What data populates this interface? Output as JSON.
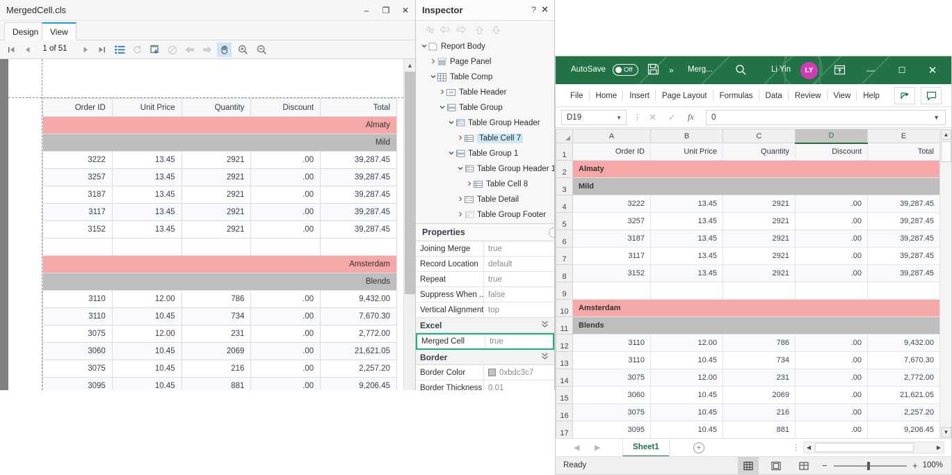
{
  "designer": {
    "title": "MergedCell.cls",
    "window_buttons": {
      "minimize": "–",
      "maximize": "❐",
      "close": "✕"
    },
    "tabs": [
      {
        "label": "Design",
        "active": false
      },
      {
        "label": "View",
        "active": true
      }
    ],
    "toolbar": {
      "first_page": "❘◀",
      "prev_page": "◀",
      "page_indicator": "1 of 51",
      "next_page": "▶",
      "last_page": "▶❘",
      "toc_icon": "list-icon",
      "refresh_icon": "refresh-icon",
      "export_icon": "export-icon",
      "stop_icon": "stop-icon",
      "back_icon": "←",
      "forward_icon": "→",
      "pan_icon": "✋",
      "zoom_in_icon": "zoom-in-icon",
      "zoom_out_icon": "zoom-out-icon"
    }
  },
  "report": {
    "columns": [
      "Order ID",
      "Unit Price",
      "Quantity",
      "Discount",
      "Total"
    ],
    "rows": [
      {
        "type": "group",
        "label": "Almaty"
      },
      {
        "type": "sub",
        "label": "Mild"
      },
      {
        "type": "data",
        "cells": [
          "3222",
          "13.45",
          "2921",
          ".00",
          "39,287.45"
        ]
      },
      {
        "type": "data",
        "cells": [
          "3257",
          "13.45",
          "2921",
          ".00",
          "39,287.45"
        ]
      },
      {
        "type": "data",
        "cells": [
          "3187",
          "13.45",
          "2921",
          ".00",
          "39,287.45"
        ]
      },
      {
        "type": "data",
        "cells": [
          "3117",
          "13.45",
          "2921",
          ".00",
          "39,287.45"
        ]
      },
      {
        "type": "data",
        "cells": [
          "3152",
          "13.45",
          "2921",
          ".00",
          "39,287.45"
        ]
      },
      {
        "type": "blank",
        "cells": [
          "",
          "",
          "",
          "",
          ""
        ]
      },
      {
        "type": "group",
        "label": "Amsterdam"
      },
      {
        "type": "sub",
        "label": "Blends"
      },
      {
        "type": "data",
        "cells": [
          "3110",
          "12.00",
          "786",
          ".00",
          "9,432.00"
        ]
      },
      {
        "type": "data",
        "cells": [
          "3110",
          "10.45",
          "734",
          ".00",
          "7,670.30"
        ]
      },
      {
        "type": "data",
        "cells": [
          "3075",
          "12.00",
          "231",
          ".00",
          "2,772.00"
        ]
      },
      {
        "type": "data",
        "cells": [
          "3060",
          "10.45",
          "2069",
          ".00",
          "21,621.05"
        ]
      },
      {
        "type": "data",
        "cells": [
          "3075",
          "10.45",
          "216",
          ".00",
          "2,257.20"
        ]
      },
      {
        "type": "data",
        "cells": [
          "3095",
          "10.45",
          "881",
          ".00",
          "9,206.45"
        ]
      }
    ]
  },
  "inspector": {
    "title": "Inspector",
    "help_icon": "?",
    "close_icon": "✕",
    "toolbar_icons": [
      "undo-arrow-icon",
      "left-arrow-icon",
      "right-arrow-icon",
      "up-arrow-icon",
      "down-arrow-icon"
    ],
    "tree": [
      {
        "label": "Report Body",
        "depth": 0,
        "twist": "⌄",
        "icon": "report-body-icon",
        "selected": false
      },
      {
        "label": "Page Panel",
        "depth": 1,
        "twist": "›",
        "icon": "page-panel-icon",
        "selected": false
      },
      {
        "label": "Table Comp",
        "depth": 1,
        "twist": "⌄",
        "icon": "table-grid-icon",
        "selected": false
      },
      {
        "label": "Table Header",
        "depth": 2,
        "twist": "›",
        "icon": "table-header-icon",
        "selected": false
      },
      {
        "label": "Table Group",
        "depth": 2,
        "twist": "⌄",
        "icon": "table-group-icon",
        "selected": false
      },
      {
        "label": "Table Group Header",
        "depth": 3,
        "twist": "⌄",
        "icon": "table-group-header-icon",
        "selected": false
      },
      {
        "label": "Table Cell 7",
        "depth": 4,
        "twist": "›",
        "icon": "table-cell-icon",
        "selected": true
      },
      {
        "label": "Table Group 1",
        "depth": 3,
        "twist": "⌄",
        "icon": "table-group-icon",
        "selected": false
      },
      {
        "label": "Table Group Header 1",
        "depth": 4,
        "twist": "⌄",
        "icon": "table-group-header-icon",
        "selected": false
      },
      {
        "label": "Table Cell 8",
        "depth": 5,
        "twist": "›",
        "icon": "table-cell-icon",
        "selected": false
      },
      {
        "label": "Table Detail",
        "depth": 4,
        "twist": "›",
        "icon": "table-detail-icon",
        "selected": false
      },
      {
        "label": "Table Group Footer",
        "depth": 4,
        "twist": "›",
        "icon": "table-group-footer-icon",
        "selected": false
      }
    ]
  },
  "properties": {
    "title": "Properties",
    "rows": [
      {
        "kind": "prop",
        "name": "Joining Merge",
        "value": "true"
      },
      {
        "kind": "prop",
        "name": "Record Location",
        "value": "default"
      },
      {
        "kind": "prop",
        "name": "Repeat",
        "value": "true"
      },
      {
        "kind": "prop",
        "name": "Suppress When ...",
        "value": "false"
      },
      {
        "kind": "prop",
        "name": "Vertical Alignment",
        "value": "top"
      },
      {
        "kind": "section",
        "name": "Excel",
        "value": ""
      },
      {
        "kind": "prop-highlight",
        "name": "Merged Cell",
        "value": "true"
      },
      {
        "kind": "section",
        "name": "Border",
        "value": ""
      },
      {
        "kind": "prop-swatch",
        "name": "Border Color",
        "value": "0xbdc3c7",
        "swatch": "#bdc3c7"
      },
      {
        "kind": "prop",
        "name": "Border Thickness",
        "value": "0.01"
      }
    ],
    "highlight_color": "#16b187"
  },
  "excel": {
    "autosave_label": "AutoSave",
    "autosave_state": "Off",
    "save_icon": "save-icon",
    "more_icon": "»",
    "document_name": "Merg...",
    "search_icon": "search-icon",
    "user_name": "Li Yin",
    "user_initials": "LY",
    "ribbon_display_icon": "ribbon-display-options-icon",
    "window_buttons": {
      "minimize": "—",
      "maximize": "☐",
      "close": "✕"
    },
    "ribbon_tabs": [
      "File",
      "Home",
      "Insert",
      "Page Layout",
      "Formulas",
      "Data",
      "Review",
      "View",
      "Help"
    ],
    "share_icon": "share-icon",
    "comment_icon": "comment-icon",
    "name_box": "D19",
    "fx_label": "fx",
    "formula_value": "0",
    "cancel_icon": "✕",
    "enter_icon": "✓",
    "titlebar_color": "#217346",
    "columns": [
      "A",
      "B",
      "C",
      "D",
      "E"
    ],
    "selected_column": "D",
    "row_numbers": [
      "1",
      "2",
      "3",
      "4",
      "5",
      "6",
      "7",
      "8",
      "9",
      "10",
      "11",
      "12",
      "13",
      "14",
      "15",
      "16",
      "17"
    ],
    "grid_rows": [
      {
        "type": "header",
        "cells": [
          "Order ID",
          "Unit Price",
          "Quantity",
          "Discount",
          "Total"
        ]
      },
      {
        "type": "group",
        "label": "Almaty"
      },
      {
        "type": "sub",
        "label": "Mild"
      },
      {
        "type": "data",
        "cells": [
          "3222",
          "13.45",
          "2921",
          ".00",
          "39,287.45"
        ]
      },
      {
        "type": "data",
        "cells": [
          "3257",
          "13.45",
          "2921",
          ".00",
          "39,287.45"
        ]
      },
      {
        "type": "data",
        "cells": [
          "3187",
          "13.45",
          "2921",
          ".00",
          "39,287.45"
        ]
      },
      {
        "type": "data",
        "cells": [
          "3117",
          "13.45",
          "2921",
          ".00",
          "39,287.45"
        ]
      },
      {
        "type": "data",
        "cells": [
          "3152",
          "13.45",
          "2921",
          ".00",
          "39,287.45"
        ]
      },
      {
        "type": "blank",
        "cells": [
          "",
          "",
          "",
          "",
          ""
        ]
      },
      {
        "type": "group",
        "label": "Amsterdam"
      },
      {
        "type": "sub",
        "label": "Blends"
      },
      {
        "type": "data",
        "cells": [
          "3110",
          "12.00",
          "786",
          ".00",
          "9,432.00"
        ]
      },
      {
        "type": "data",
        "cells": [
          "3110",
          "10.45",
          "734",
          ".00",
          "7,670.30"
        ]
      },
      {
        "type": "data",
        "cells": [
          "3075",
          "12.00",
          "231",
          ".00",
          "2,772.00"
        ]
      },
      {
        "type": "data",
        "cells": [
          "3060",
          "10.45",
          "2069",
          ".00",
          "21,621.05"
        ]
      },
      {
        "type": "data",
        "cells": [
          "3075",
          "10.45",
          "216",
          ".00",
          "2,257.20"
        ]
      },
      {
        "type": "data",
        "cells": [
          "3095",
          "10.45",
          "881",
          ".00",
          "9,206.45"
        ]
      }
    ],
    "sheet_tab": "Sheet1",
    "add_sheet_icon": "+",
    "status_text": "Ready",
    "view_buttons": [
      "normal-view-icon",
      "page-layout-view-icon",
      "page-break-view-icon"
    ],
    "zoom_level": "100%",
    "zoom_minus": "−",
    "zoom_plus": "+"
  }
}
